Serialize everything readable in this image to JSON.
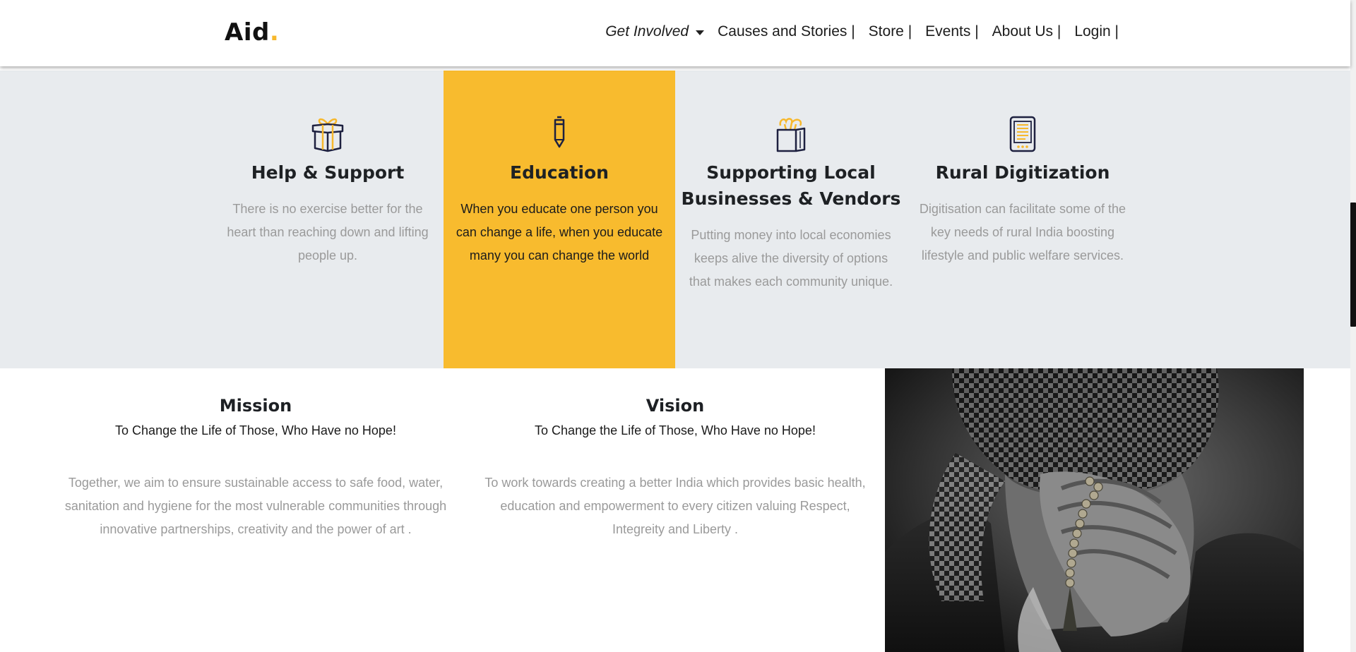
{
  "header": {
    "logo_text": "Aid",
    "logo_dot": ".",
    "nav": [
      {
        "label": "Get Involved",
        "icon": "caret-down-icon"
      },
      {
        "label": "Causes and Stories |"
      },
      {
        "label": "Store |"
      },
      {
        "label": "Events |"
      },
      {
        "label": "About Us |"
      },
      {
        "label": "Login |"
      }
    ]
  },
  "services": [
    {
      "icon": "gift-box-icon",
      "title": "Help & Support",
      "text": "There is no exercise better for the heart than reaching down and lifting people up."
    },
    {
      "icon": "pencil-icon",
      "title": "Education",
      "text": "When you educate one person you can change a life, when you educate many you can change the world"
    },
    {
      "icon": "grocery-bag-icon",
      "title": "Supporting Local Businesses & Vendors",
      "text": "Putting money into local economies keeps alive the diversity of options that makes each community unique."
    },
    {
      "icon": "tablet-icon",
      "title": "Rural Digitization",
      "text": "Digitisation can facilitate some of the key needs of rural India boosting lifestyle and public welfare services."
    }
  ],
  "mission": {
    "title": "Mission",
    "subtitle": "To Change the Life of Those, Who Have no Hope!",
    "body": "Together, we aim to ensure sustainable access to safe food, water, sanitation and hygiene for the most vulnerable communities through innovative partnerships, creativity and the power of art ."
  },
  "vision": {
    "title": "Vision",
    "subtitle": "To Change the Life of Those, Who Have no Hope!",
    "body": "To work towards creating a better India which provides basic health, education and empowerment to every citizen valuing Respect, Integreity and Liberty ."
  },
  "photo": {
    "subject": "monochrome-portrait-man-covering-face-with-prayer-beads"
  },
  "colors": {
    "accent": "#f8bb2e",
    "band": "#e8ebee",
    "muted_text": "#9a9a9a",
    "dark_text": "#1e2124"
  }
}
